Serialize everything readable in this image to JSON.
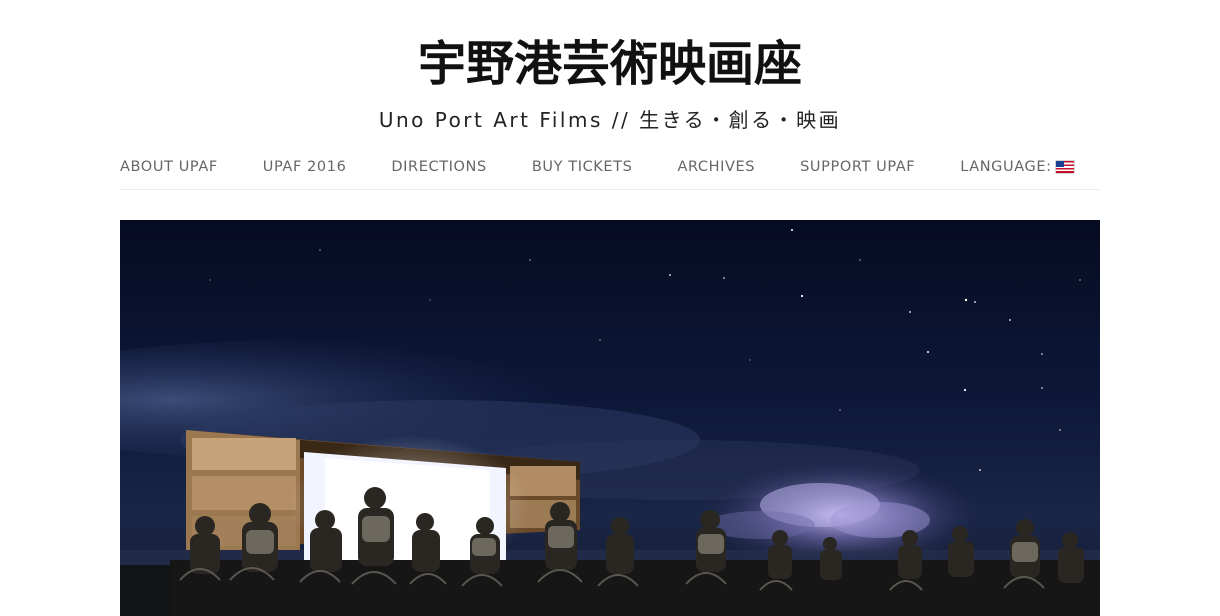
{
  "site": {
    "title": "宇野港芸術映画座",
    "tagline": "Uno Port Art Films // 生きる・創る・映画"
  },
  "nav": {
    "items": [
      {
        "label": "ABOUT UPAF"
      },
      {
        "label": "UPAF 2016"
      },
      {
        "label": "DIRECTIONS"
      },
      {
        "label": "BUY TICKETS"
      },
      {
        "label": "ARCHIVES"
      },
      {
        "label": "SUPPORT UPAF"
      },
      {
        "label": "LANGUAGE:",
        "icon": "us-flag-icon"
      }
    ]
  },
  "hero": {
    "image": "outdoor-film-screening-night-sky-photo",
    "colors": {
      "sky_top": "#070d25",
      "sky_mid": "#101b3e",
      "cloud": "#3a4c78",
      "screen": "#f4f6ff",
      "ground": "#121212"
    }
  }
}
